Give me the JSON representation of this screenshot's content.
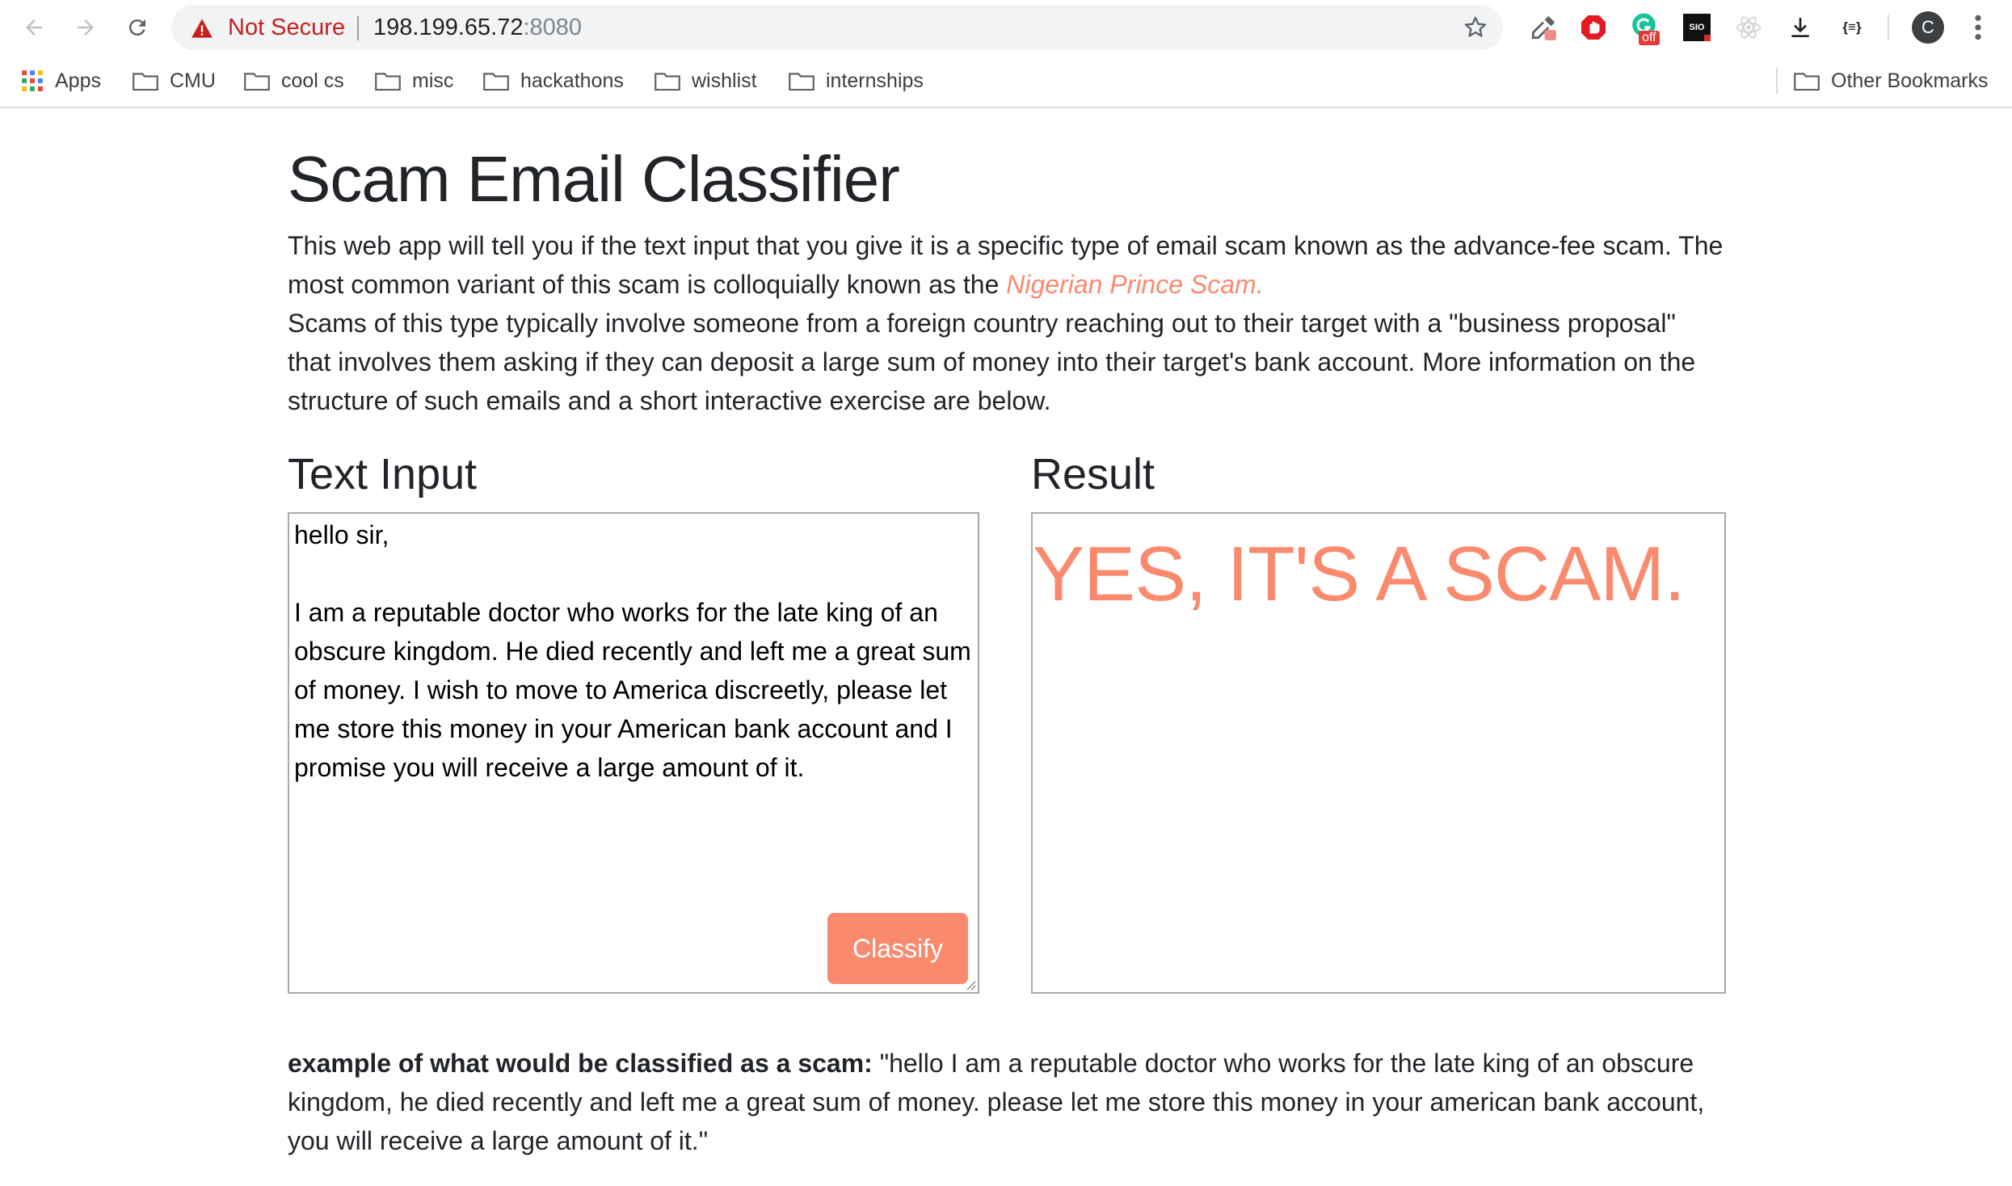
{
  "browser": {
    "not_secure_label": "Not Secure",
    "url_host": "198.199.65.72",
    "url_port": ":8080",
    "extensions": [
      "eyedropper-icon",
      "adblock-icon",
      "grammarly-icon",
      "sio-icon",
      "react-icon",
      "download-icon",
      "json-icon"
    ],
    "grammarly_badge": "off",
    "sio_label": "SIO",
    "json_label": "{≡}",
    "profile_initial": "C"
  },
  "bookmarks": {
    "apps_label": "Apps",
    "items": [
      "CMU",
      "cool cs",
      "misc",
      "hackathons",
      "wishlist",
      "internships"
    ],
    "other_label": "Other Bookmarks"
  },
  "page": {
    "title": "Scam Email Classifier",
    "intro_part1": "This web app will tell you if the text input that you give it is a specific type of email scam known as the advance-fee scam. The most common variant of this scam is colloquially known as the ",
    "intro_link": "Nigerian Prince Scam.",
    "intro_part2": "Scams of this type typically involve someone from a foreign country reaching out to their target with a \"business proposal\" that involves them asking if they can deposit a large sum of money into their target's bank account. More information on the structure of such emails and a short interactive exercise are below.",
    "input_heading": "Text Input",
    "result_heading": "Result",
    "input_text": "hello sir,\n\nI am a reputable doctor who works for the late king of an obscure kingdom. He died recently and left me a great sum of money. I wish to move to America discreetly, please let me store this money in your American bank account and I promise you will receive a large amount of it.",
    "classify_label": "Classify",
    "result_text": "YES, IT'S A SCAM.",
    "example_label": "example of what would be classified as a scam:",
    "example_text": " \"hello I am a reputable doctor who works for the late king of an obscure kingdom, he died recently and left me a great sum of money. please let me store this money in your american bank account, you will receive a large amount of it.\""
  },
  "colors": {
    "accent": "#fa8a6e",
    "warning": "#c5221f"
  }
}
